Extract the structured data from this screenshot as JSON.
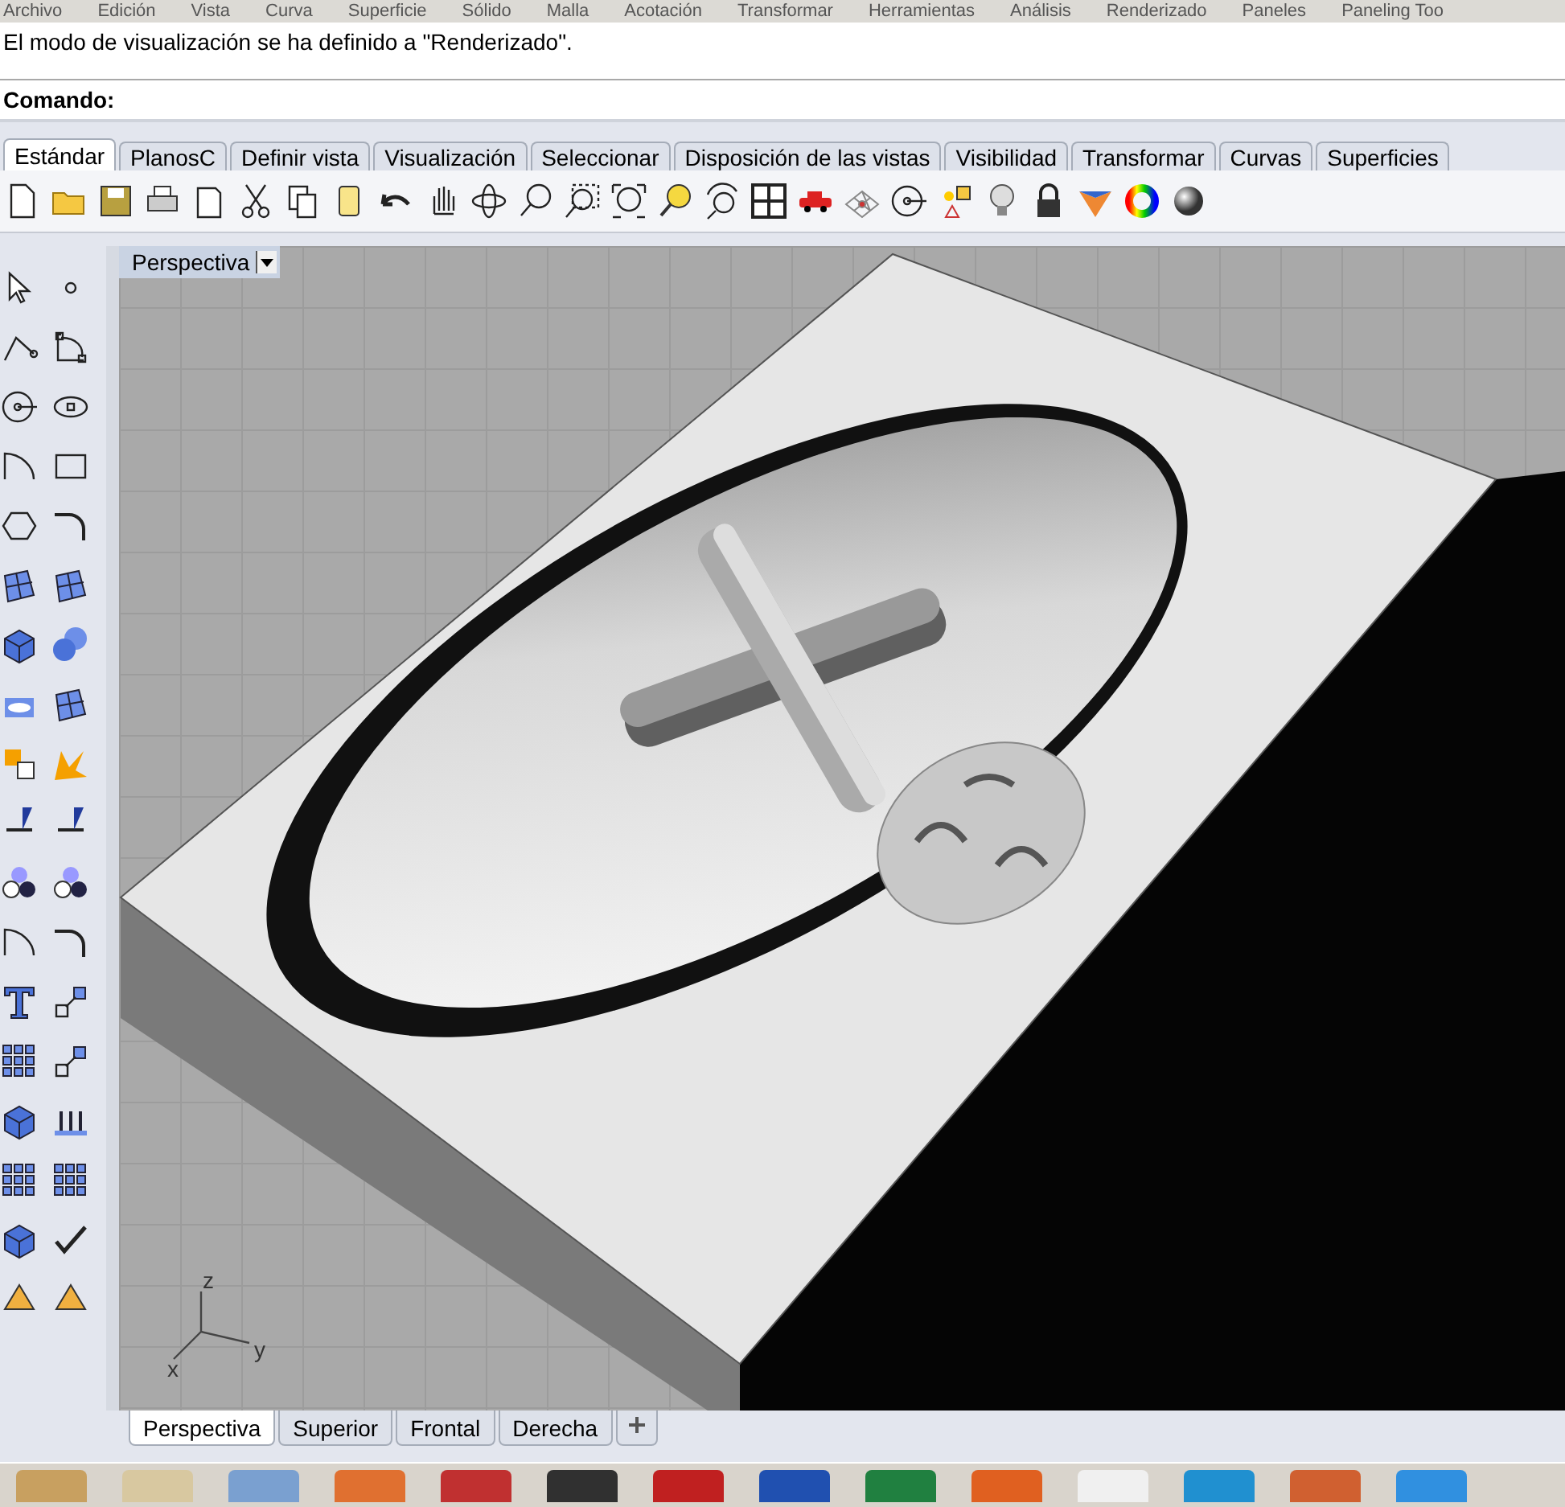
{
  "menu": [
    "Archivo",
    "Edición",
    "Vista",
    "Curva",
    "Superficie",
    "Sólido",
    "Malla",
    "Acotación",
    "Transformar",
    "Herramientas",
    "Análisis",
    "Renderizado",
    "Paneles",
    "Paneling Too"
  ],
  "history": {
    "message": "El modo de visualización se ha definido a \"Renderizado\"."
  },
  "command": {
    "label": "Comando:"
  },
  "toolbar_tabs": [
    {
      "label": "Estándar",
      "selected": true
    },
    {
      "label": "PlanosC",
      "selected": false
    },
    {
      "label": "Definir vista",
      "selected": false
    },
    {
      "label": "Visualización",
      "selected": false
    },
    {
      "label": "Seleccionar",
      "selected": false
    },
    {
      "label": "Disposición de las vistas",
      "selected": false
    },
    {
      "label": "Visibilidad",
      "selected": false
    },
    {
      "label": "Transformar",
      "selected": false
    },
    {
      "label": "Curvas",
      "selected": false
    },
    {
      "label": "Superficies",
      "selected": false
    }
  ],
  "viewport": {
    "title": "Perspectiva",
    "axis_labels": {
      "z": "z",
      "y": "y",
      "x": "x"
    }
  },
  "viewport_tabs": [
    {
      "label": "Perspectiva",
      "selected": true
    },
    {
      "label": "Superior",
      "selected": false
    },
    {
      "label": "Frontal",
      "selected": false
    },
    {
      "label": "Derecha",
      "selected": false
    }
  ]
}
